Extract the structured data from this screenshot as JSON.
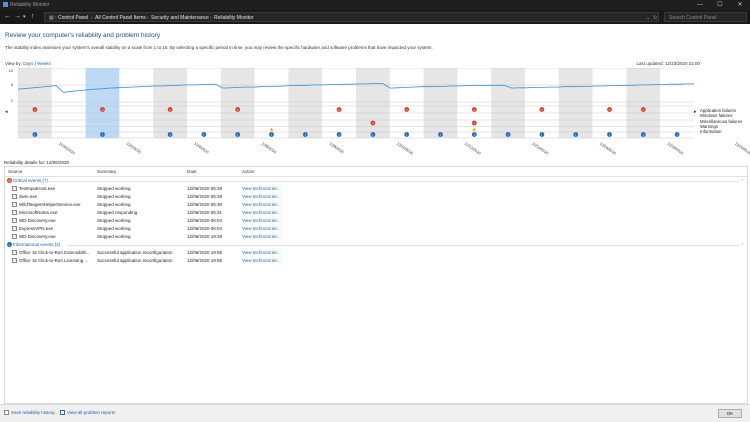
{
  "window": {
    "title": "Reliability Monitor",
    "buttons": [
      "—",
      "☐",
      "✕"
    ]
  },
  "address_bar": {
    "crumbs": [
      "Control Panel",
      "All Control Panel Items",
      "Security and Maintenance",
      "Reliability Monitor"
    ],
    "search_placeholder": "Search Control Panel"
  },
  "page": {
    "heading": "Review your computer's reliability and problem history",
    "description": "The stability index assesses your system's overall stability on a scale from 1 to 10. By selecting a specific period in time, you may review the specific hardware and software problems that have impacted your system.",
    "view_by_label": "View by:",
    "view_days": "Days",
    "view_sep": "|",
    "view_weeks": "Weeks",
    "last_updated": "Last updated: 12/23/2020 22:00"
  },
  "chart_data": {
    "type": "line",
    "ylim": [
      1,
      10
    ],
    "y_ticks": [
      "10",
      "5",
      "1"
    ],
    "selected_column": 3,
    "x_labels": [
      "11/30/2020",
      "12/2/2020",
      "12/4/2020",
      "12/6/2020",
      "12/8/2020",
      "12/10/2020",
      "12/12/2020",
      "12/14/2020",
      "12/16/2020",
      "12/18/2020",
      "12/20/2020",
      "12/22/2020"
    ],
    "stability_index": [
      4.6,
      4.8,
      5.0,
      5.2,
      5.4,
      5.6,
      3.7,
      4.0,
      4.2,
      4.4,
      4.6,
      4.7,
      4.9,
      5.0,
      5.1,
      5.2,
      5.3,
      5.4,
      5.5,
      5.5,
      5.6,
      5.7,
      5.8,
      5.8,
      5.9,
      5.9,
      6.0,
      4.9,
      5.0,
      5.1,
      5.2,
      5.2,
      5.3,
      5.4,
      5.4,
      5.5,
      5.6,
      5.7,
      5.7,
      5.8,
      5.8,
      5.9,
      5.9,
      6.0,
      6.0,
      6.1,
      6.1,
      6.2,
      6.2,
      4.9,
      5.0,
      5.1,
      5.2,
      5.3,
      5.3,
      5.4,
      5.4,
      5.5,
      5.5,
      5.6,
      5.6,
      5.6,
      5.7,
      5.7,
      5.7,
      4.9,
      5.0,
      5.0,
      5.1,
      5.1,
      5.2,
      5.2,
      5.3,
      5.3,
      5.4,
      5.4,
      5.5,
      5.5,
      5.6,
      5.6,
      5.7,
      5.7,
      5.8,
      5.8,
      5.9,
      5.9,
      6.0,
      6.0,
      6.1,
      6.1
    ],
    "categories": [
      "Application failures",
      "Windows failures",
      "Miscellaneous failures",
      "Warnings",
      "Information"
    ],
    "app_failures": [
      0,
      2,
      4,
      6,
      9,
      11,
      13,
      15,
      17,
      18
    ],
    "misc_failures": [
      10,
      13
    ],
    "misc_failures_hint": "error rows",
    "warnings": [
      7,
      13
    ],
    "information": [
      0,
      2,
      4,
      5,
      6,
      7,
      8,
      9,
      10,
      11,
      12,
      13,
      14,
      15,
      16,
      17,
      18,
      19
    ]
  },
  "row_labels": [
    "Application failures",
    "Windows failures",
    "Miscellaneous failures",
    "Warnings",
    "Information"
  ],
  "details": {
    "header": "Reliability details for: 12/06/2020",
    "columns": [
      "Source",
      "Summary",
      "Date",
      "Action"
    ],
    "critical_label": "Critical events (7)",
    "critical_rows": [
      {
        "source": "TextInputHost.exe",
        "summary": "Stopped working",
        "date": "12/06/2020 05:29",
        "action": "View technical de..."
      },
      {
        "source": "dwm.exe",
        "summary": "Stopped working",
        "date": "12/06/2020 05:29",
        "action": "View technical de..."
      },
      {
        "source": "WildTangentHelperService.exe",
        "summary": "Stopped working",
        "date": "12/06/2020 05:30",
        "action": "View technical de..."
      },
      {
        "source": "MicrosoftNotes.exe",
        "summary": "Stopped responding",
        "date": "12/06/2020 05:31",
        "action": "View technical de..."
      },
      {
        "source": "WD Discovery.exe",
        "summary": "Stopped working",
        "date": "12/06/2020 06:04",
        "action": "View technical de..."
      },
      {
        "source": "ExpressVPN.exe",
        "summary": "Stopped working",
        "date": "12/06/2020 06:04",
        "action": "View technical de..."
      },
      {
        "source": "WD Discovery.exe",
        "summary": "Stopped working",
        "date": "12/06/2020 19:29",
        "action": "View technical de..."
      }
    ],
    "info_label": "Informational events (2)",
    "info_rows": [
      {
        "source": "Office 16 Click-to-Run Extensibilit...",
        "summary": "Successful application reconfiguration",
        "date": "12/06/2020 19:55",
        "action": "View technical de..."
      },
      {
        "source": "Office 16 Click-to-Run Licensing ...",
        "summary": "Successful application reconfiguration",
        "date": "12/06/2020 19:55",
        "action": "View technical de..."
      }
    ]
  },
  "footer": {
    "save_link": "Save reliability history...",
    "view_all_link": "View all problem reports",
    "ok_label": "OK"
  },
  "colors": {
    "error": "#d9402b",
    "warning": "#f2b51d",
    "info": "#1d6fc0",
    "selected": "#bcd9f5",
    "line": "#3b8fd0",
    "band": "#e6e6e6"
  }
}
